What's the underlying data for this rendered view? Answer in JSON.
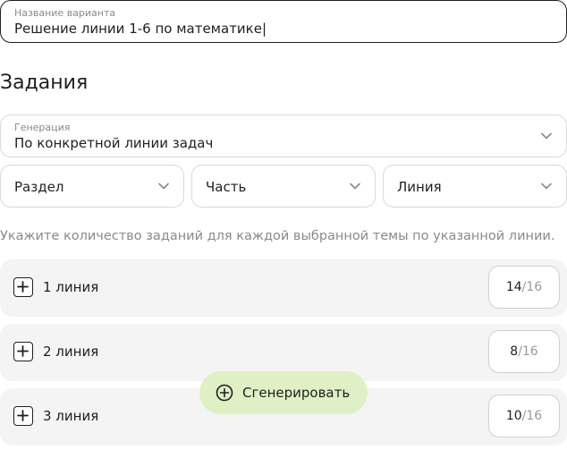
{
  "variant_name": {
    "label": "Название варианта",
    "value": "Решение линии 1-6 по математике|"
  },
  "section_title": "Задания",
  "generation": {
    "label": "Генерация",
    "value": "По конкретной линии задач"
  },
  "filters": {
    "section": "Раздел",
    "part": "Часть",
    "line": "Линия"
  },
  "hint": "Укажите количество заданий для каждой выбранной темы по указанной линии.",
  "lines": [
    {
      "label": "1 линия",
      "count": "14",
      "total": "/16"
    },
    {
      "label": "2 линия",
      "count": "8",
      "total": "/16"
    },
    {
      "label": "3 линия",
      "count": "10",
      "total": "/16"
    }
  ],
  "generate_button": "Сгенерировать",
  "colors": {
    "accent_button_bg": "#dff0c4",
    "row_bg": "#f4f4f4",
    "border": "#d9d9d9",
    "text": "#1f1f1f",
    "muted": "#8a8a8a"
  },
  "icons": {
    "dropdown": "chevron-down-icon",
    "expand": "plus-icon",
    "generate": "plus-circle-icon"
  }
}
